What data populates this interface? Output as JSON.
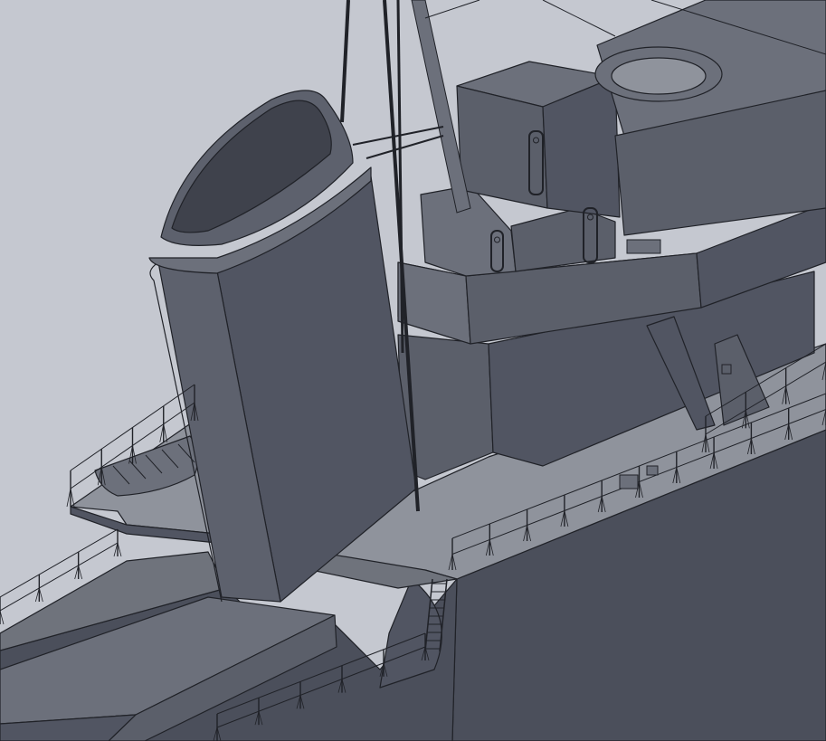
{
  "scene": {
    "colors": {
      "background": "#c5c8d0",
      "hull": "#4b4f5b",
      "deck": "#8f939c",
      "deck_shadow": "#6f737c",
      "superstructure_light": "#6c707b",
      "superstructure_mid": "#5b5f6a",
      "superstructure_dark": "#515562",
      "funnel_front": "#5d616d",
      "funnel_side": "#515562",
      "funnel_cap": "#3f424c",
      "outline": "#202228"
    },
    "icons": {
      "funnel": "funnel-icon",
      "mast": "mast-icon",
      "railing": "railing-icon",
      "ladder": "ladder-icon",
      "lifeboat": "lifeboat-icon",
      "porthole": "porthole-icon"
    }
  }
}
